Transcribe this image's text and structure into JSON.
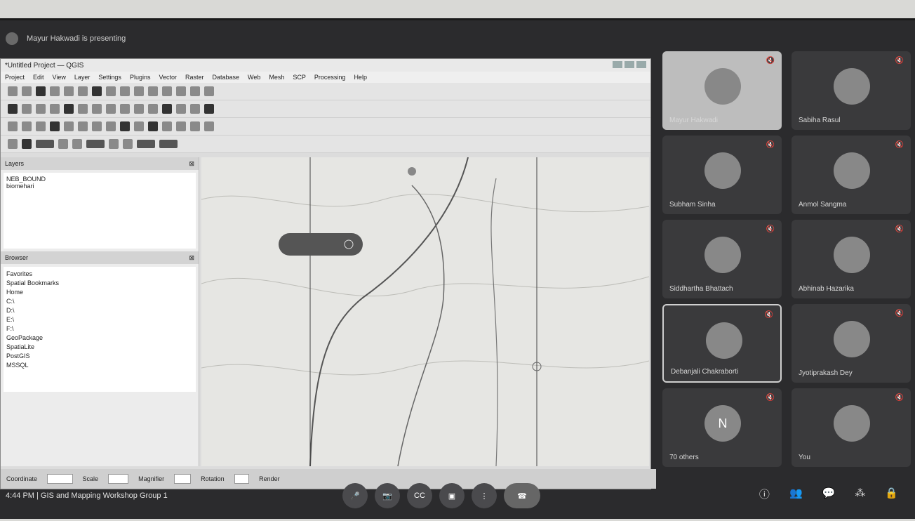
{
  "presenter": {
    "text": "Mayur Hakwadi is presenting"
  },
  "qgis": {
    "title": "*Untitled Project — QGIS",
    "menu": [
      "Project",
      "Edit",
      "View",
      "Layer",
      "Settings",
      "Plugins",
      "Vector",
      "Raster",
      "Database",
      "Web",
      "Mesh",
      "SCP",
      "Processing",
      "Help"
    ],
    "layers_title": "Layers",
    "layers": [
      "NEB_BOUND",
      "biomehari"
    ],
    "browser_title": "Browser",
    "browser": [
      "Favorites",
      "Spatial Bookmarks",
      "Home",
      "C:\\",
      "D:\\",
      "E:\\",
      "F:\\",
      "GeoPackage",
      "SpatiaLite",
      "PostGIS",
      "MSSQL"
    ],
    "status": {
      "coordinate_label": "Coordinate",
      "scale_label": "Scale",
      "magnifier_label": "Magnifier",
      "rotation_label": "Rotation",
      "render_label": "Render"
    }
  },
  "participants": [
    {
      "name": "Mayur Hakwadi",
      "initial": ""
    },
    {
      "name": "Sabiha Rasul",
      "initial": ""
    },
    {
      "name": "Subham Sinha",
      "initial": ""
    },
    {
      "name": "Anmol Sangma",
      "initial": ""
    },
    {
      "name": "Siddhartha Bhattach",
      "initial": ""
    },
    {
      "name": "Abhinab Hazarika",
      "initial": ""
    },
    {
      "name": "Debanjali Chakraborti",
      "initial": ""
    },
    {
      "name": "Jyotiprakash Dey",
      "initial": ""
    },
    {
      "name": "70 others",
      "initial": "N"
    },
    {
      "name": "You",
      "initial": ""
    }
  ],
  "meeting": {
    "info": "4:44 PM  |  GIS and Mapping Workshop Group 1"
  }
}
